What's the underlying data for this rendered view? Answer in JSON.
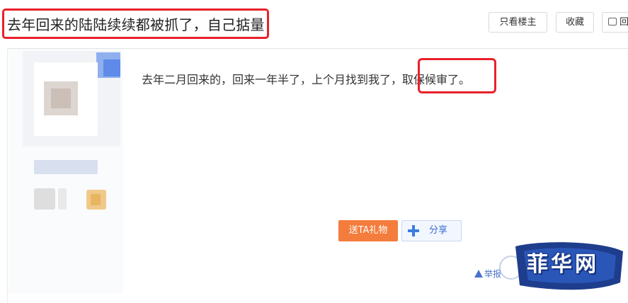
{
  "thread": {
    "title": "去年回来的陆陆续续都被抓了，自己掂量"
  },
  "toolbar": {
    "only_owner_label": "只看楼主",
    "favorite_label": "收藏",
    "reply_label": "回"
  },
  "post": {
    "content": "去年二月回来的，回来一年半了，上个月找到我了，取保候审了。",
    "gift_label": "送TA礼物",
    "share_label": "分享",
    "report_label": "举报"
  },
  "watermark": {
    "text": "菲华网"
  },
  "colors": {
    "highlight": "#e8212a",
    "gift": "#f47c3c",
    "link": "#4a73c9",
    "watermark_blue": "#1e3d8c"
  }
}
